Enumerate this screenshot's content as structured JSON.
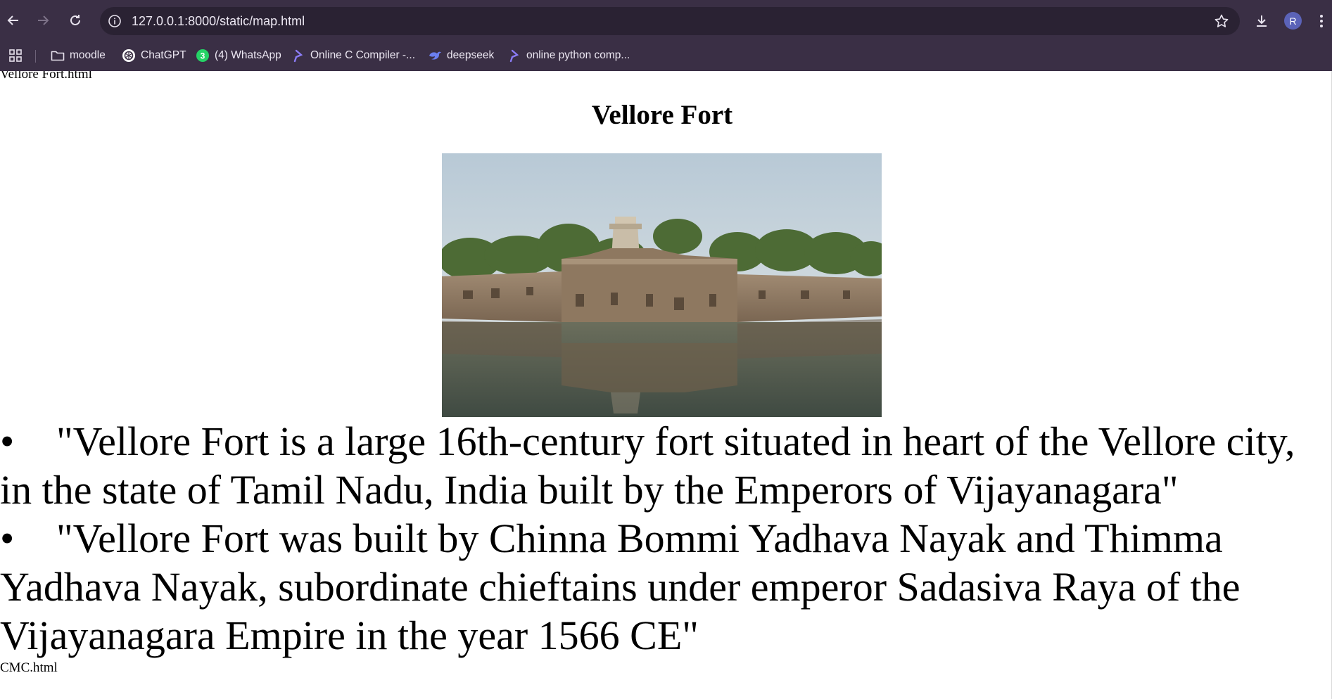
{
  "browser": {
    "url": "127.0.0.1:8000/static/map.html",
    "profile_initial": "R",
    "icons": {
      "back": "back-arrow-icon",
      "forward": "forward-arrow-icon",
      "reload": "reload-icon",
      "site_info": "info-icon",
      "bookmark_star": "star-icon",
      "downloads": "download-icon",
      "menu": "kebab-menu-icon",
      "apps": "apps-grid-icon"
    },
    "bookmarks": [
      {
        "label": "moodle",
        "icon": "folder-icon"
      },
      {
        "label": "ChatGPT",
        "icon": "chatgpt-icon"
      },
      {
        "label": "(4) WhatsApp",
        "icon": "whatsapp-icon",
        "badge": "3"
      },
      {
        "label": "Online C Compiler -...",
        "icon": "programiz-icon"
      },
      {
        "label": "deepseek",
        "icon": "deepseek-icon"
      },
      {
        "label": "online python comp...",
        "icon": "programiz-icon"
      }
    ],
    "colors": {
      "chrome": "#3a2f45",
      "omnibox": "#2a2233",
      "avatar": "#5b63b8"
    }
  },
  "page": {
    "top_link": "Vellore Fort.html",
    "title": "Vellore Fort",
    "image_alt": "Vellore Fort",
    "facts": [
      "\"Vellore Fort is a large 16th-century fort situated in heart of the Vellore city, in the state of Tamil Nadu, India built by the Emperors of Vijayanagara\"",
      "\"Vellore Fort was built by Chinna Bommi Yadhava Nayak and Thimma Yadhava Nayak, subordinate chieftains under emperor Sadasiva Raya of the Vijayanagara Empire in the year 1566 CE\""
    ],
    "bullet": "•",
    "bottom_link": "CMC.html"
  }
}
